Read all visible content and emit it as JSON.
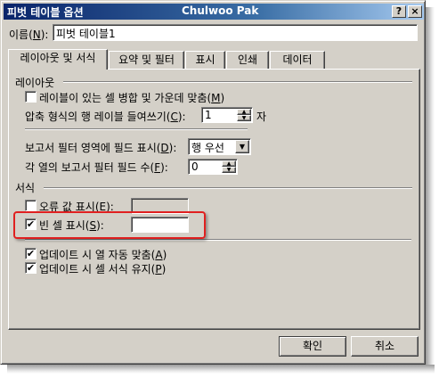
{
  "window": {
    "title": "피벗 테이블 옵션",
    "center_caption": "Chulwoo Pak",
    "help_glyph": "?",
    "close_glyph": "×"
  },
  "name_field": {
    "label_pre": "이름(",
    "label_key": "N",
    "label_post": "):",
    "value": "피벗 테이블1"
  },
  "tabs": [
    {
      "label": "레이아웃 및 서식",
      "active": true
    },
    {
      "label": "요약 및 필터",
      "active": false
    },
    {
      "label": "표시",
      "active": false
    },
    {
      "label": "인쇄",
      "active": false
    },
    {
      "label": "데이터",
      "active": false
    }
  ],
  "layout_section": {
    "heading": "레이아웃",
    "merge_label_pre": "레이블이 있는 셀 병합 및 가운데 맞춤(",
    "merge_label_key": "M",
    "merge_label_post": ")",
    "merge_checked": false,
    "indent_label_pre": "압축 형식의 행 레이블 들여쓰기(",
    "indent_label_key": "C",
    "indent_label_post": "):",
    "indent_value": "1",
    "indent_unit": "자",
    "filter_area_label_pre": "보고서 필터 영역에 필드 표시(",
    "filter_area_label_key": "D",
    "filter_area_label_post": "):",
    "filter_area_value": "행 우선",
    "filter_count_label_pre": "각 열의 보고서 필터 필드 수(",
    "filter_count_label_key": "F",
    "filter_count_label_post": "):",
    "filter_count_value": "0"
  },
  "format_section": {
    "heading": "서식",
    "error_label_pre": "오류 값 표시(",
    "error_label_key": "E",
    "error_label_post": "):",
    "error_checked": false,
    "error_value": "",
    "empty_label_pre": "빈 셀 표시(",
    "empty_label_key": "S",
    "empty_label_post": "):",
    "empty_checked": true,
    "empty_value": "",
    "autofit_label_pre": "업데이트 시 열 자동 맞춤(",
    "autofit_label_key": "A",
    "autofit_label_post": ")",
    "autofit_checked": true,
    "preserve_label_pre": "업데이트 시 셀 서식 유지(",
    "preserve_label_key": "P",
    "preserve_label_post": ")",
    "preserve_checked": true
  },
  "buttons": {
    "ok": "확인",
    "cancel": "취소"
  },
  "glyphs": {
    "check": "✔",
    "spin_up": "▲",
    "spin_down": "▼",
    "dropdown": "▼"
  },
  "colors": {
    "highlight": "#e02020",
    "titlebar_start": "#0a246a",
    "titlebar_end": "#a6caf0",
    "face": "#d4d0c8"
  }
}
